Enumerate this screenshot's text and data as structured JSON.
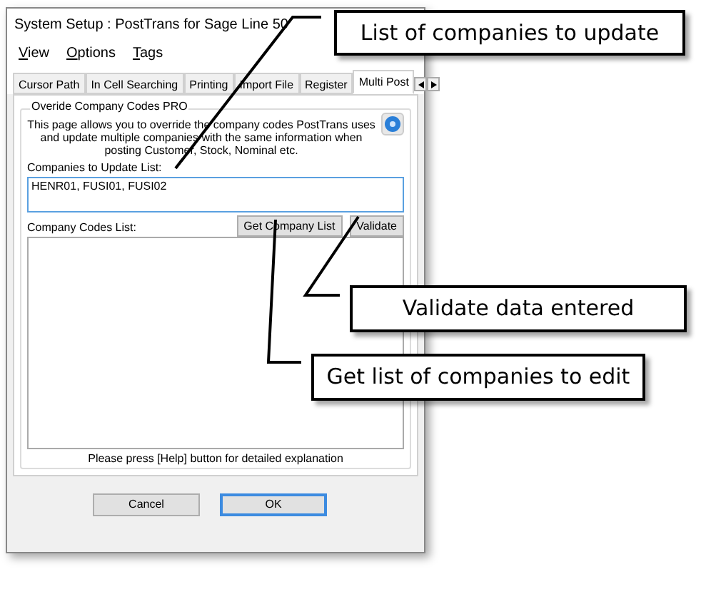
{
  "window": {
    "title": "System Setup : PostTrans for Sage Line 50"
  },
  "menu": [
    "View",
    "Options",
    "Tags"
  ],
  "tabs": [
    {
      "label": "Cursor Path",
      "selected": false
    },
    {
      "label": "In Cell Searching",
      "selected": false
    },
    {
      "label": "Printing",
      "selected": false
    },
    {
      "label": "Import File",
      "selected": false
    },
    {
      "label": "Register",
      "selected": false
    },
    {
      "label": "Multi Post",
      "selected": true
    }
  ],
  "group": {
    "title": "Overide Company Codes PRO",
    "description": "This page allows you to override the company codes PostTrans uses and update multiple companies with the same information when posting Customer, Stock, Nominal etc."
  },
  "companies_field": {
    "label": "Companies to Update List:",
    "value": "HENR01, FUSI01, FUSI02"
  },
  "codes_list": {
    "label": "Company Codes List:",
    "buttons": [
      "Get Company List",
      "Validate"
    ]
  },
  "help_text": "Please press [Help] button for detailed explanation",
  "buttons": [
    {
      "label": "Cancel",
      "default": false
    },
    {
      "label": "OK",
      "default": true
    }
  ],
  "callouts": [
    "List of companies to update",
    "Validate data entered",
    "Get list of companies to edit"
  ]
}
